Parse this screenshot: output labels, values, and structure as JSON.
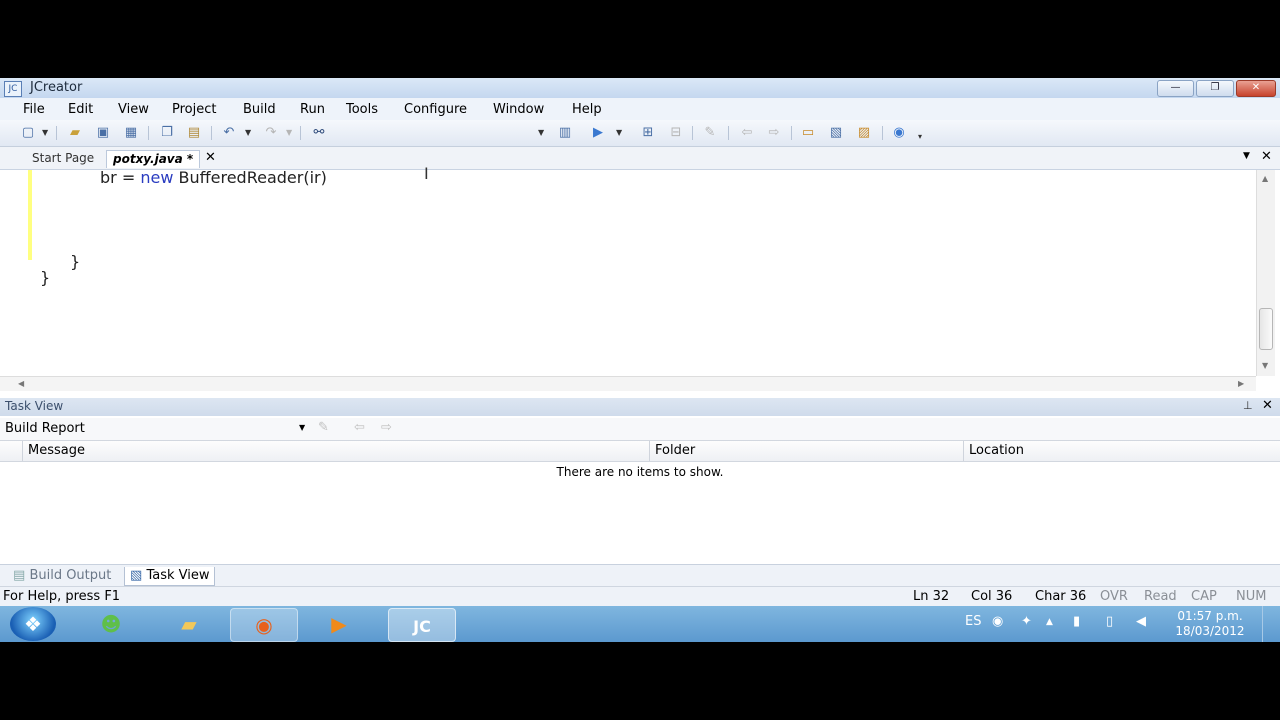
{
  "window": {
    "title": "JCreator",
    "controls": {
      "minimize": "—",
      "maximize": "❐",
      "close": "✕"
    }
  },
  "menu": [
    "File",
    "Edit",
    "View",
    "Project",
    "Build",
    "Run",
    "Tools",
    "Configure",
    "Window",
    "Help"
  ],
  "toolbar": {
    "icons": [
      "new-file-icon",
      "open-icon",
      "save-icon",
      "save-all-icon",
      "copy-icon",
      "paste-icon",
      "undo-icon",
      "redo-icon",
      "find-icon",
      "project-icon",
      "run-icon",
      "compile-icon",
      "build-icon",
      "debug-icon",
      "back-icon",
      "forward-icon",
      "window-icon",
      "options-icon",
      "help-icon"
    ]
  },
  "tabs": {
    "start_page": "Start Page",
    "active_file": "potxy.java *",
    "close_symbol": "✕"
  },
  "editor": {
    "line1_var": "br",
    "line1_op": "=",
    "line1_kw": "new",
    "line1_rest": "BufferedReader(ir)",
    "brace_inner": "}",
    "brace_outer": "}"
  },
  "task_view": {
    "title": "Task View",
    "dropdown_value": "Build Report",
    "columns": [
      "Message",
      "Folder",
      "Location"
    ],
    "empty_message": "There are no items to show."
  },
  "bottom_tabs": {
    "build_output": "Build Output",
    "task_view": "Task View"
  },
  "status": {
    "help": "For Help, press F1",
    "ln": "Ln 32",
    "col": "Col 36",
    "char": "Char 36",
    "ovr": "OVR",
    "read": "Read",
    "cap": "CAP",
    "num": "NUM"
  },
  "taskbar": {
    "language": "ES",
    "time": "01:57 p.m.",
    "date": "18/03/2012"
  }
}
